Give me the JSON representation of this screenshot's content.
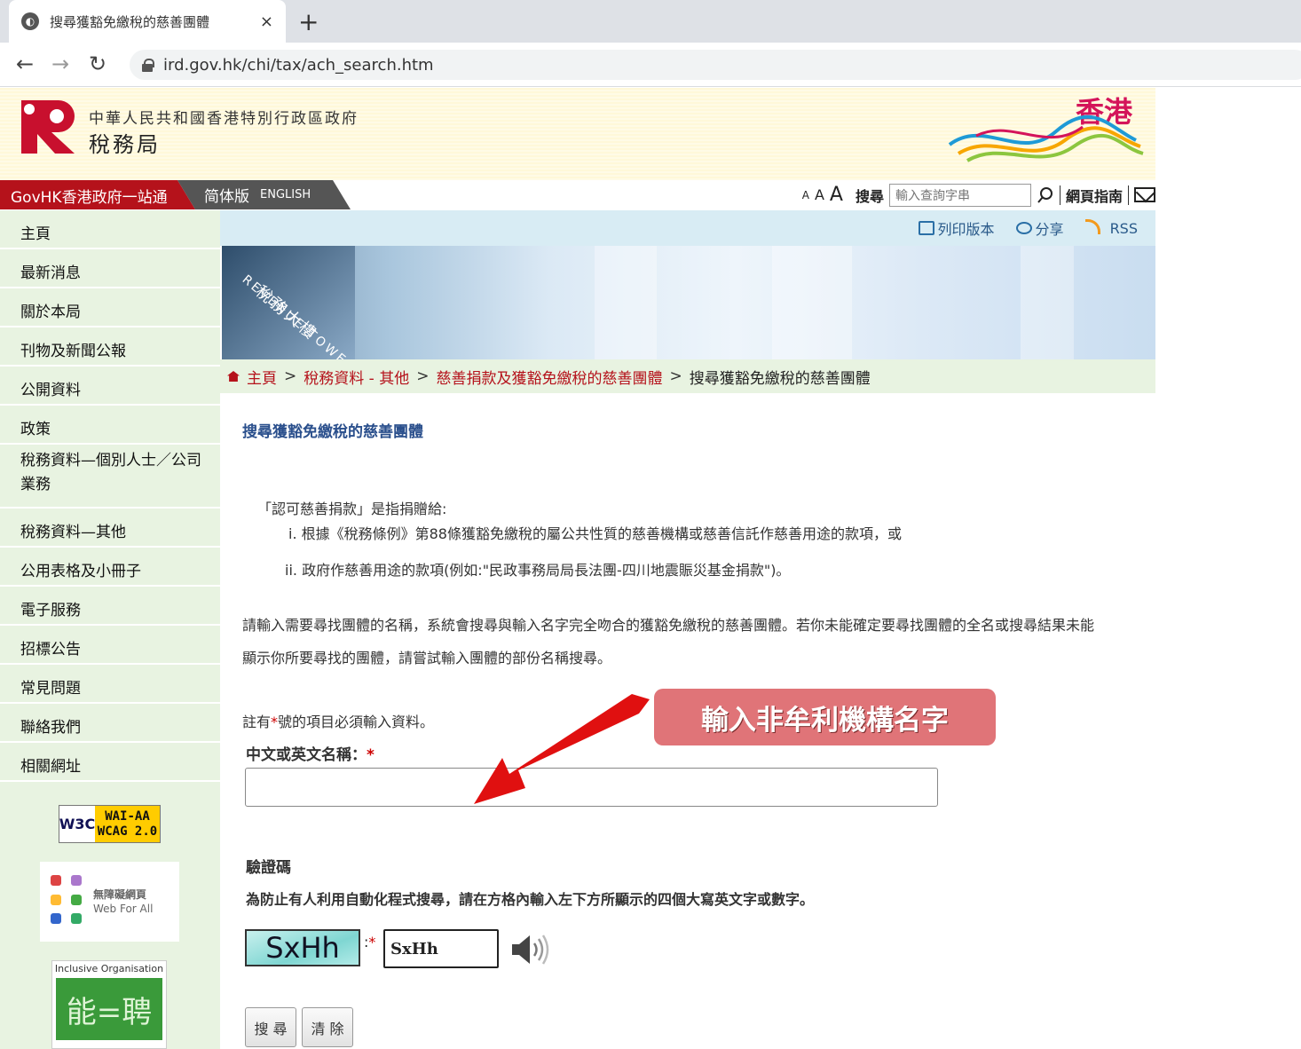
{
  "browser": {
    "tab_title": "搜尋獲豁免繳稅的慈善團體",
    "close_glyph": "×",
    "newtab_glyph": "+",
    "url": "ird.gov.hk/chi/tax/ach_search.htm"
  },
  "header": {
    "gov_name": "中華人民共和國香港特別行政區政府",
    "dept_name": "稅務局",
    "brand": "香港"
  },
  "topnav": {
    "govhk": "GovHK香港政府一站通",
    "lang_sc": "简体版",
    "lang_en": "ENGLISH",
    "font_small": "A",
    "font_medium": "A",
    "font_large": "A",
    "search_label": "搜尋",
    "search_placeholder": "輸入查詢字串",
    "site_guide": "網頁指南"
  },
  "sidebar": {
    "items": [
      {
        "label": "主頁"
      },
      {
        "label": "最新消息"
      },
      {
        "label": "關於本局"
      },
      {
        "label": "刊物及新聞公報"
      },
      {
        "label": "公開資料"
      },
      {
        "label": "政策"
      },
      {
        "label": "稅務資料—個別人士／公司業務"
      },
      {
        "label": "稅務資料—其他"
      },
      {
        "label": "公用表格及小冊子"
      },
      {
        "label": "電子服務"
      },
      {
        "label": "招標公告"
      },
      {
        "label": "常見問題"
      },
      {
        "label": "聯絡我們"
      },
      {
        "label": "相關網址"
      }
    ],
    "badge_w3c": "W3C",
    "badge_wai_1": "WAI-AA",
    "badge_wai_2": "WCAG 2.0",
    "badge_wfa_1": "無障礙網頁",
    "badge_wfa_2": "Web For All",
    "badge_io_title": "Inclusive Organisation",
    "badge_io_mark": "能=聘"
  },
  "tools": {
    "print": "列印版本",
    "share": "分享",
    "rss": "RSS"
  },
  "banner": {
    "text_en": "REVENUE TOWER",
    "text_zh": "稅務大樓"
  },
  "breadcrumb": {
    "home": "主頁",
    "sep": ">",
    "level1": "稅務資料 - 其他",
    "level2": "慈善捐款及獲豁免繳稅的慈善團體",
    "current": "搜尋獲豁免繳稅的慈善團體"
  },
  "main": {
    "title": "搜尋獲豁免繳稅的慈善團體",
    "def_intro": "「認可慈善捐款」是指捐贈給:",
    "def_item1": "i. 根據《稅務條例》第88條獲豁免繳稅的屬公共性質的慈善機構或慈善信託作慈善用途的款項，或",
    "def_item2": "ii. 政府作慈善用途的款項(例如:\"民政事務局局長法團-四川地震賑災基金捐款\")。",
    "instr_line1": "請輸入需要尋找團體的名稱，系統會搜尋與輸入名字完全吻合的獲豁免繳稅的慈善團體。若你未能確定要尋找團體的全名或搜尋結果未能",
    "instr_line2": "顯示你所要尋找的團體，請嘗試輸入團體的部份名稱搜尋。",
    "note_pre": "註有",
    "note_star": "*",
    "note_post": "號的項目必須輸入資料。",
    "field_label": "中文或英文名稱：",
    "field_star": "*",
    "captcha_heading": "驗證碼",
    "captcha_desc": "為防止有人利用自動化程式搜尋，請在方格內輸入左下方所顯示的四個大寫英文字或數字。",
    "captcha_image_text": "SxHh",
    "captcha_colon": ":",
    "captcha_value": "SxHh",
    "search_button": "搜 尋",
    "clear_button": "清 除"
  },
  "annotation": {
    "callout": "輸入非牟利機構名字",
    "arrow_color": "#e01010",
    "callout_color": "#e07478"
  }
}
